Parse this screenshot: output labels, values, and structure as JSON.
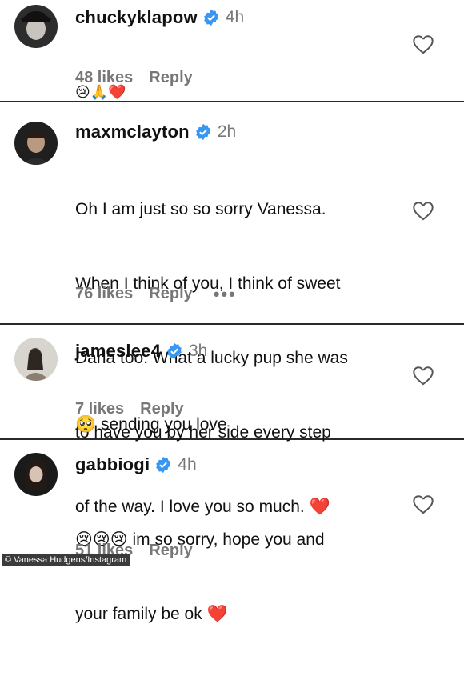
{
  "comments": [
    {
      "username": "chuckyklapow",
      "time": "4h",
      "lines": [
        "😢🙏❤️"
      ],
      "likes": "48 likes",
      "reply": "Reply"
    },
    {
      "username": "maxmclayton",
      "time": "2h",
      "lines": [
        "Oh I am just so so sorry Vanessa.",
        "When I think of you, I think of sweet",
        "Darla too. What a lucky pup she was",
        "to have you by her side every step",
        "of the way. I love you so much. ❤️"
      ],
      "likes": "76 likes",
      "reply": "Reply",
      "more": "•••"
    },
    {
      "username": "jameslee4",
      "time": "3h",
      "lines": [
        "🥺 sending you love"
      ],
      "likes": "7 likes",
      "reply": "Reply"
    },
    {
      "username": "gabbiogi",
      "time": "4h",
      "lines": [
        "😢😢😢 im so sorry, hope you and",
        "your family be ok ❤️"
      ],
      "likes": "51 likes",
      "reply": "Reply"
    }
  ],
  "icons": {
    "verified": "verified-badge-icon",
    "like": "heart-outline-icon",
    "verified_color": "#3897f0",
    "heart_color": "#e11d2a"
  },
  "credit": "© Vanessa Hudgens/Instagram"
}
